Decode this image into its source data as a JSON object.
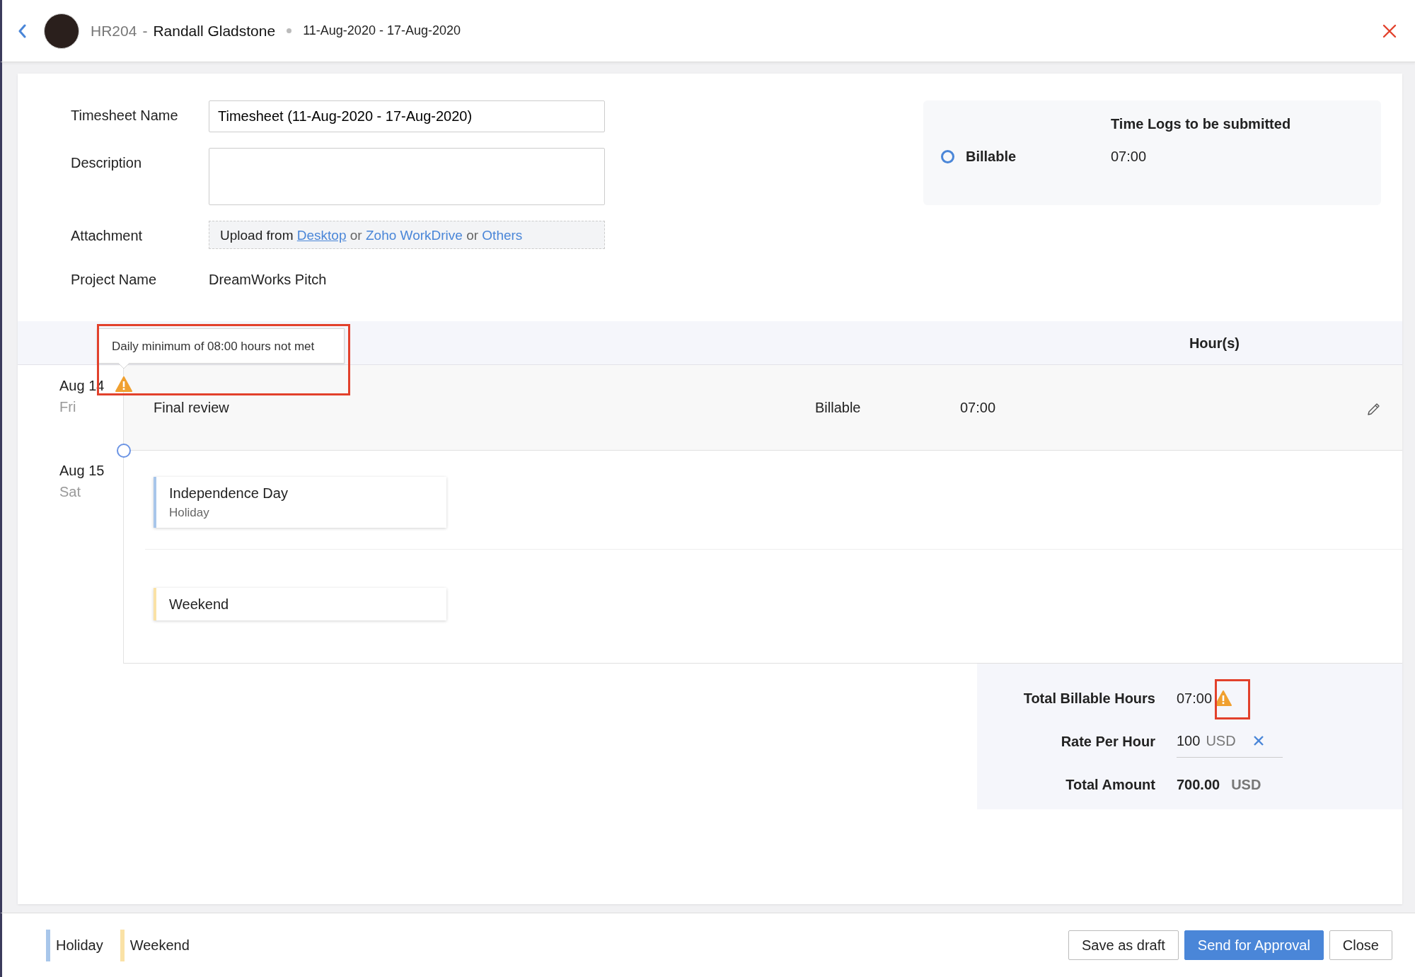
{
  "header": {
    "employee_id": "HR204",
    "separator": "-",
    "employee_name": "Randall Gladstone",
    "date_range": "11-Aug-2020 - 17-Aug-2020"
  },
  "form": {
    "fields": [
      {
        "kind": "input",
        "label": "Timesheet Name",
        "value": "Timesheet (11-Aug-2020 - 17-Aug-2020)"
      },
      {
        "kind": "textarea",
        "label": "Description"
      },
      {
        "kind": "upload",
        "label": "Attachment",
        "parts": [
          {
            "kind": "text",
            "text": "Upload from"
          },
          {
            "kind": "link",
            "text": "Desktop",
            "underlined": true
          },
          {
            "kind": "joiner",
            "text": "or"
          },
          {
            "kind": "link",
            "text": "Zoho WorkDrive",
            "underlined": false
          },
          {
            "kind": "joiner",
            "text": "or"
          },
          {
            "kind": "link",
            "text": "Others",
            "underlined": false
          }
        ]
      },
      {
        "kind": "text",
        "label": "Project Name",
        "value": "DreamWorks Pitch"
      }
    ]
  },
  "summary": {
    "title": "Time Logs to be submitted",
    "rows": [
      {
        "label": "Billable",
        "value": "07:00"
      }
    ]
  },
  "table": {
    "columns": [
      "Hour(s)"
    ],
    "days": [
      {
        "date": "Aug 14",
        "weekday": "Fri",
        "warning": true,
        "highlighted": true,
        "tooltip": "Daily minimum of 08:00 hours not met",
        "entries": [
          {
            "kind": "log",
            "job": "Final review",
            "billing": "Billable",
            "hours": "07:00"
          }
        ]
      },
      {
        "date": "Aug 15",
        "weekday": "Sat",
        "warning": false,
        "highlighted": false,
        "entries": [
          {
            "kind": "holiday",
            "title": "Independence Day",
            "subtitle": "Holiday",
            "color": "#a8c6ea"
          },
          {
            "kind": "weekend",
            "title": "Weekend",
            "color": "#fae2a6"
          }
        ]
      }
    ]
  },
  "totals": [
    {
      "kind": "hours",
      "label": "Total Billable Hours",
      "value": "07:00",
      "warning": true,
      "highlighted": true
    },
    {
      "kind": "rate",
      "label": "Rate Per Hour",
      "value": "100",
      "unit": "USD"
    },
    {
      "kind": "amount",
      "label": "Total Amount",
      "value": "700.00",
      "unit": "USD"
    }
  ],
  "legend": [
    {
      "label": "Holiday",
      "color": "#a8c6ea"
    },
    {
      "label": "Weekend",
      "color": "#fae2a6"
    }
  ],
  "buttons": [
    {
      "kind": "secondary",
      "label": "Save as draft"
    },
    {
      "kind": "primary",
      "label": "Send for Approval"
    },
    {
      "kind": "secondary",
      "label": "Close"
    }
  ]
}
